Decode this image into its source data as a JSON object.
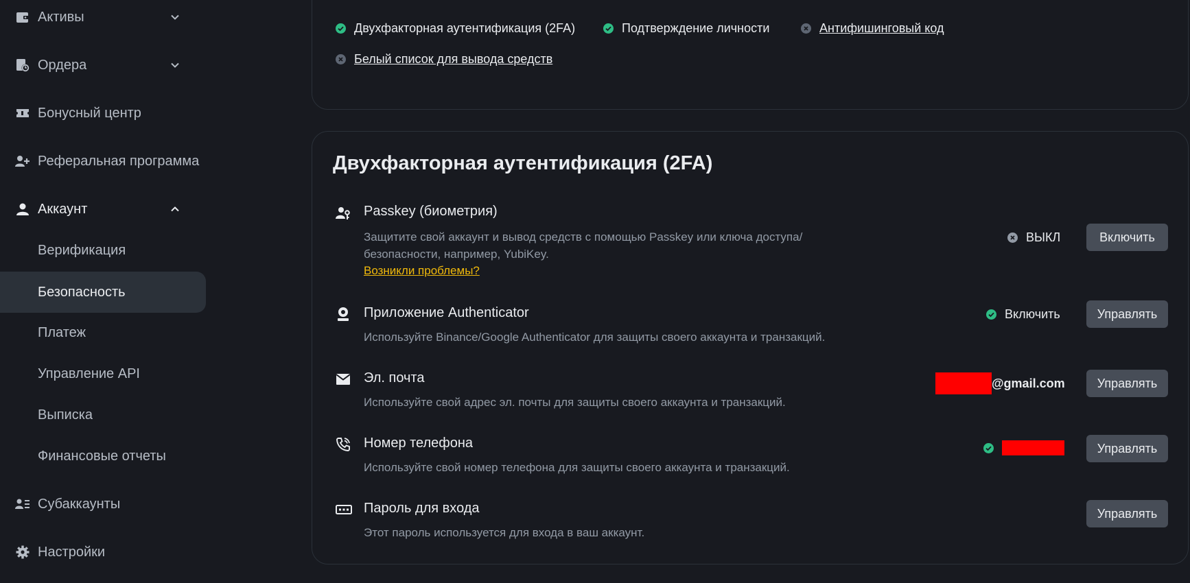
{
  "sidebar": {
    "items": [
      {
        "label": "Активы",
        "icon": "wallet-icon"
      },
      {
        "label": "Ордера",
        "icon": "orders-icon"
      },
      {
        "label": "Бонусный центр",
        "icon": "ticket-icon"
      },
      {
        "label": "Реферальная программа",
        "icon": "add-user-icon"
      },
      {
        "label": "Аккаунт",
        "icon": "user-icon"
      },
      {
        "label": "Субаккаунты",
        "icon": "subaccounts-icon"
      },
      {
        "label": "Настройки",
        "icon": "gear-icon"
      }
    ],
    "account_sub": [
      {
        "label": "Верификация"
      },
      {
        "label": "Безопасность",
        "active": true
      },
      {
        "label": "Платеж"
      },
      {
        "label": "Управление API"
      },
      {
        "label": "Выписка"
      },
      {
        "label": "Финансовые отчеты"
      }
    ]
  },
  "security_checks": {
    "items": [
      {
        "label": "Двухфакторная аутентификация (2FA)",
        "status": "ok"
      },
      {
        "label": "Подтверждение личности",
        "status": "ok"
      },
      {
        "label": "Антифишинговый код",
        "status": "off"
      },
      {
        "label": "Белый список для вывода средств",
        "status": "off"
      }
    ]
  },
  "twofa": {
    "title": "Двухфакторная аутентификация (2FA)",
    "rows": [
      {
        "icon": "passkey-icon",
        "title": "Passkey (биометрия)",
        "desc_line1": "Защитите свой аккаунт и вывод средств с помощью Passkey или ключа доступа/",
        "desc_line2": "безопасности, например, YubiKey.",
        "link": "Возникли проблемы?",
        "status": "ВЫКЛ",
        "button": "Включить"
      },
      {
        "icon": "authenticator-icon",
        "title": "Приложение Authenticator",
        "desc": "Используйте Binance/Google Authenticator для защиты своего аккаунта и транзакций.",
        "status": "Включить",
        "button": "Управлять"
      },
      {
        "icon": "mail-icon",
        "title": "Эл. почта",
        "desc": "Используйте свой адрес эл. почты для защиты своего аккаунта и транзакций.",
        "status": "@gmail.com",
        "button": "Управлять"
      },
      {
        "icon": "phone-icon",
        "title": "Номер телефона",
        "desc": "Используйте свой номер телефона для защиты своего аккаунта и транзакций.",
        "button": "Управлять"
      },
      {
        "icon": "password-icon",
        "title": "Пароль для входа",
        "desc": "Этот пароль используется для входа в ваш аккаунт.",
        "button": "Управлять"
      }
    ]
  },
  "colors": {
    "background": "#181a20",
    "success": "#2ebd85",
    "link": "#f0b90b",
    "button": "#474d57",
    "redaction": "#ff0000"
  }
}
